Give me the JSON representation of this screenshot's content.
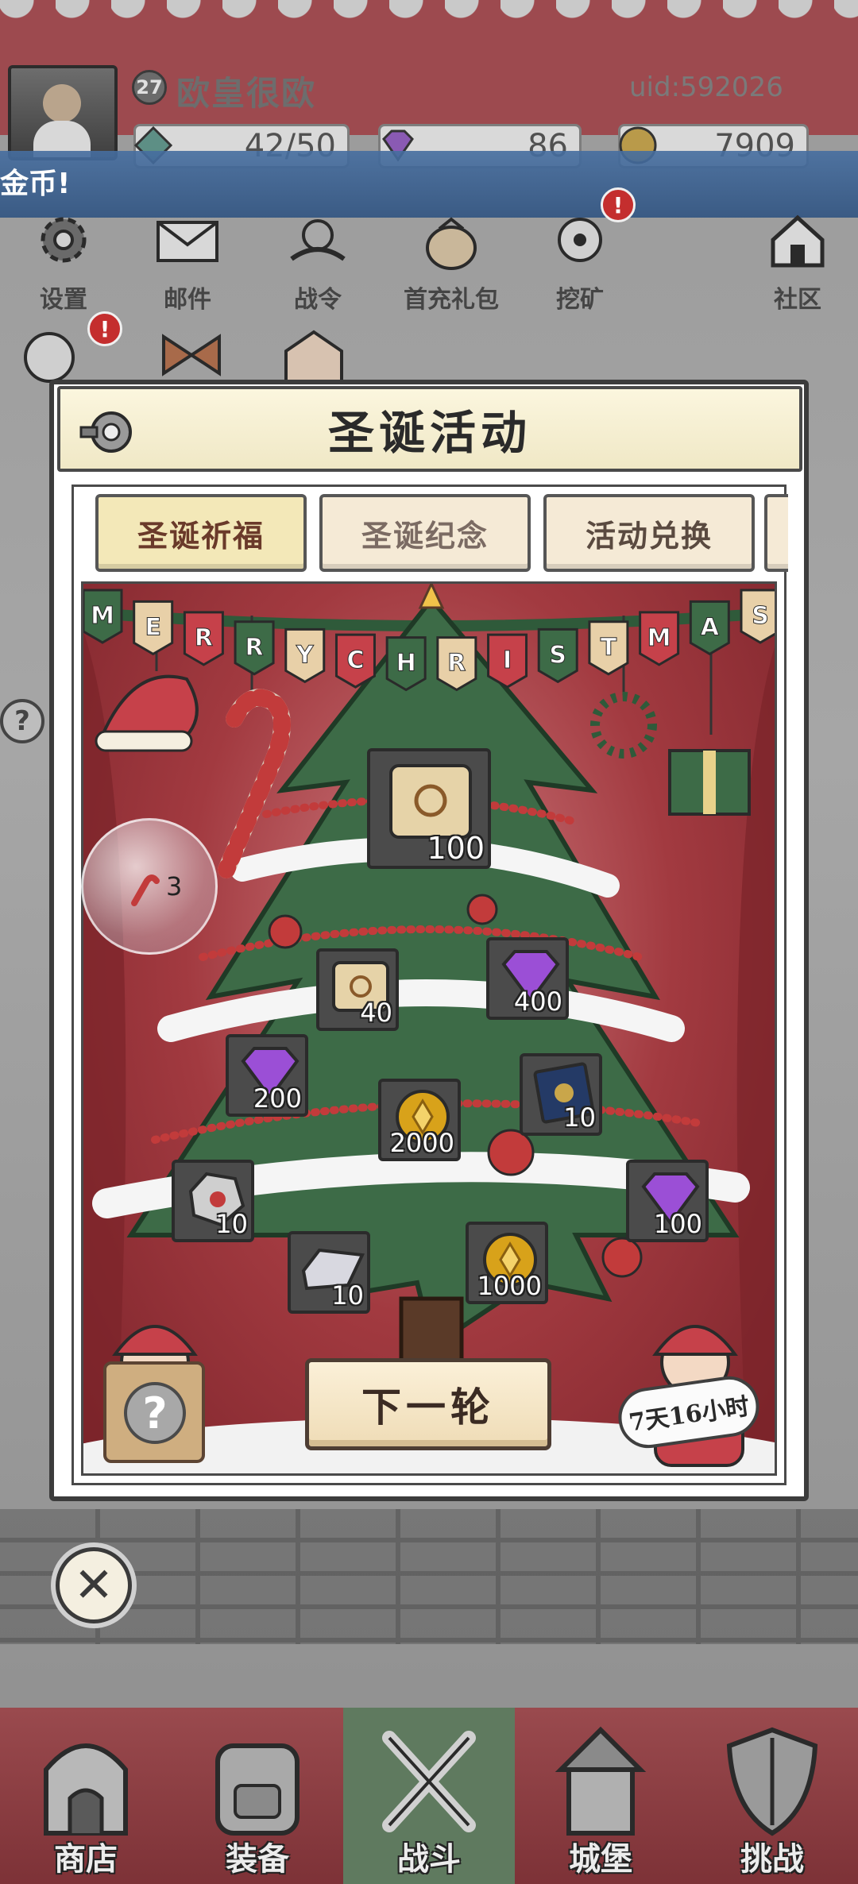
{
  "header": {
    "level": "27",
    "player_name": "欧皇很欧",
    "uid": "uid:592026",
    "energy": "42/50",
    "gems": "86",
    "coins": "7909"
  },
  "ticker": {
    "text": "金币!"
  },
  "top_icons": [
    {
      "label": "设置",
      "icon": "gear-icon"
    },
    {
      "label": "邮件",
      "icon": "mail-icon"
    },
    {
      "label": "战令",
      "icon": "battle-pass-icon"
    },
    {
      "label": "首充礼包",
      "icon": "gift-bag-icon"
    },
    {
      "label": "挖矿",
      "icon": "mining-icon"
    },
    {
      "label": "社区",
      "icon": "home-icon"
    }
  ],
  "modal": {
    "title": "圣诞活动",
    "tabs": [
      {
        "label": "圣诞祈福",
        "selected": true
      },
      {
        "label": "圣诞纪念",
        "selected": false
      },
      {
        "label": "活动兑换",
        "selected": false
      }
    ]
  },
  "banner": {
    "text": "MERRY CHRISTMAS"
  },
  "bubble": {
    "count": "3"
  },
  "rewards": [
    {
      "icon": "scroll-icon",
      "qty": "100"
    },
    {
      "icon": "scroll-icon",
      "qty": "40"
    },
    {
      "icon": "gem-icon",
      "qty": "400"
    },
    {
      "icon": "gem-icon",
      "qty": "200"
    },
    {
      "icon": "coin-icon",
      "qty": "2000"
    },
    {
      "icon": "spellbook-icon",
      "qty": "10"
    },
    {
      "icon": "ore-icon",
      "qty": "10"
    },
    {
      "icon": "gem-icon",
      "qty": "100"
    },
    {
      "icon": "silver-bar-icon",
      "qty": "10"
    },
    {
      "icon": "coin-icon",
      "qty": "1000"
    }
  ],
  "next_round_label": "下一轮",
  "timer": "7天16小时",
  "help_symbol": "?",
  "close_symbol": "✕",
  "bottom_nav": [
    {
      "label": "商店",
      "icon": "shop-icon"
    },
    {
      "label": "装备",
      "icon": "backpack-icon"
    },
    {
      "label": "战斗",
      "icon": "crossed-swords-icon",
      "active": true
    },
    {
      "label": "城堡",
      "icon": "castle-icon"
    },
    {
      "label": "挑战",
      "icon": "shield-icon"
    }
  ],
  "colors": {
    "stage_red": "#a23a40",
    "tree_green": "#3d6b47",
    "tab_selected": "#f3e8b8",
    "gem_purple": "#9b4fd6",
    "coin_gold": "#d8a21a"
  }
}
